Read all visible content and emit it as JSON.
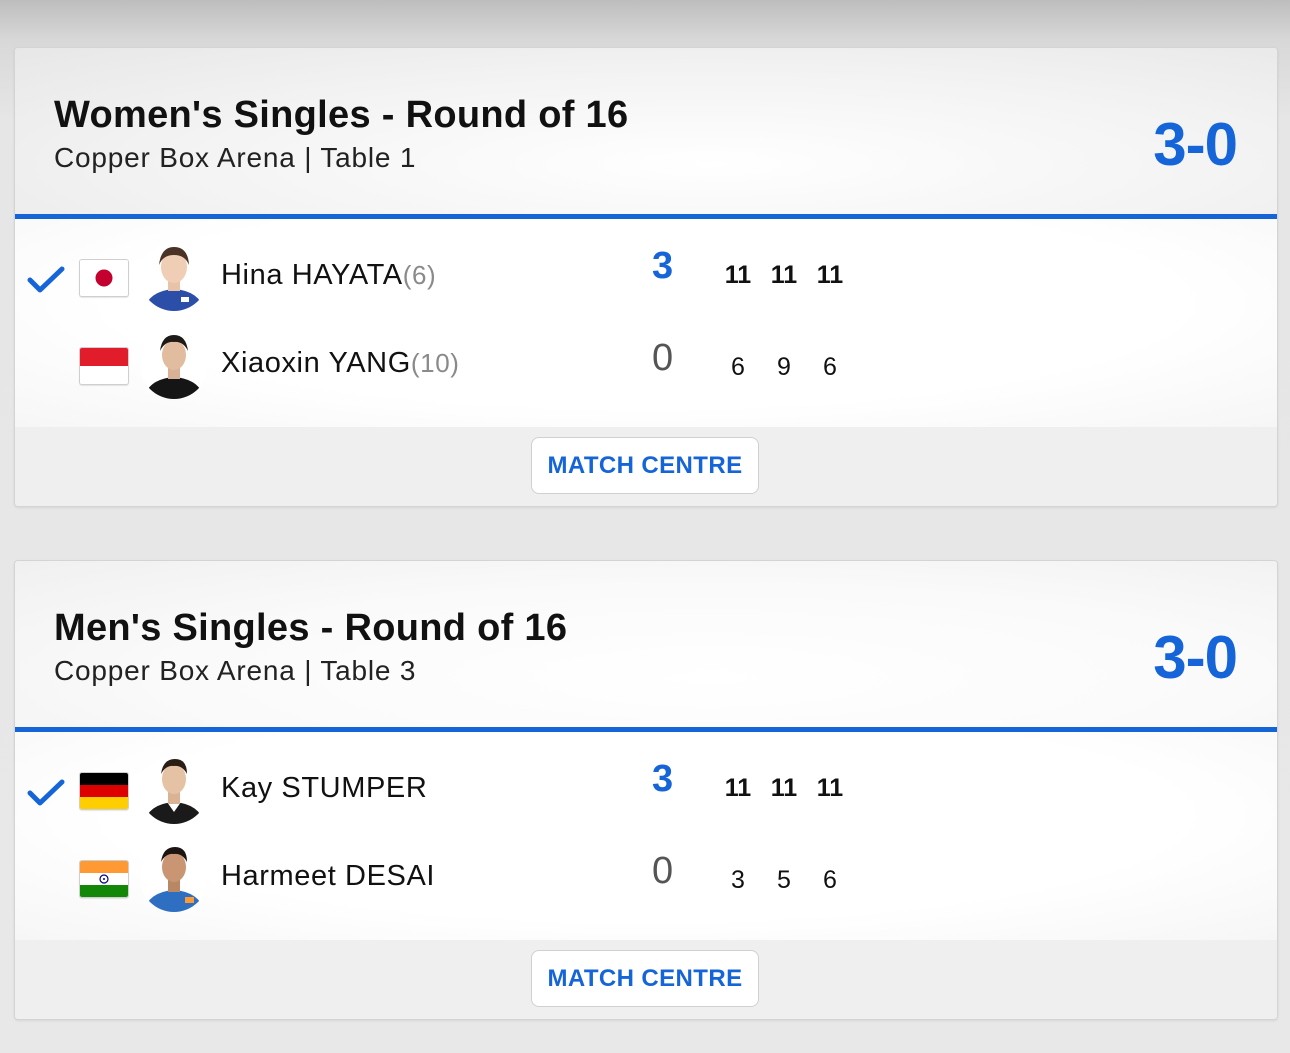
{
  "matches": [
    {
      "event_title": "Women's Singles - Round of 16",
      "venue": "Copper Box Arena | Table 1",
      "overall_score": "3-0",
      "players": [
        {
          "name": "Hina HAYATA",
          "seed": "(6)",
          "country_flag": "japan-flag",
          "sets": "3",
          "games": [
            "11",
            "11",
            "11"
          ],
          "winner": true
        },
        {
          "name": "Xiaoxin YANG",
          "seed": "(10)",
          "country_flag": "monaco-flag",
          "sets": "0",
          "games": [
            "6",
            "9",
            "6"
          ],
          "winner": false
        }
      ],
      "match_centre_label": "MATCH CENTRE"
    },
    {
      "event_title": "Men's Singles - Round of 16",
      "venue": "Copper Box Arena | Table 3",
      "overall_score": "3-0",
      "players": [
        {
          "name": "Kay STUMPER",
          "seed": "",
          "country_flag": "germany-flag",
          "sets": "3",
          "games": [
            "11",
            "11",
            "11"
          ],
          "winner": true
        },
        {
          "name": "Harmeet DESAI",
          "seed": "",
          "country_flag": "india-flag",
          "sets": "0",
          "games": [
            "3",
            "5",
            "6"
          ],
          "winner": false
        }
      ],
      "match_centre_label": "MATCH CENTRE"
    }
  ],
  "colors": {
    "accent": "#1565d8",
    "seed_gray": "#8a8a8a"
  }
}
